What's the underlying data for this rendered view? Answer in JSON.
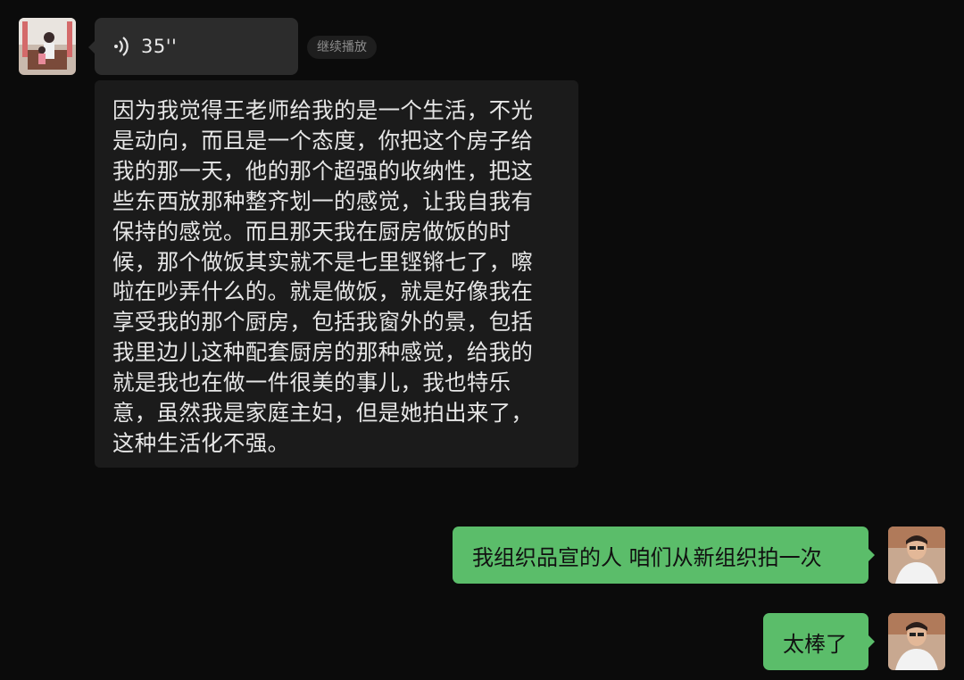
{
  "incoming": {
    "voice_message": {
      "duration": "35''",
      "action_label": "继续播放"
    },
    "transcript_lines": [
      "因为我觉得王老师给我的是一个生活，不光",
      "是动向，而且是一个态度，你把这个房子给",
      "我的那一天，他的那个超强的收纳性，把这",
      "些东西放那种整齐划一的感觉，让我自我有",
      "保持的感觉。而且那天我在厨房做饭的时",
      "候，那个做饭其实就不是七里铿锵七了，嚓",
      "啦在吵弄什么的。就是做饭，就是好像我在",
      "享受我的那个厨房，包括我窗外的景，包括",
      "我里边儿这种配套厨房的那种感觉，给我的",
      "就是我也在做一件很美的事儿，我也特乐",
      "意，虽然我是家庭主妇，但是她拍出来了，",
      "这种生活化不强。"
    ]
  },
  "outgoing": [
    {
      "text": "我组织品宣的人 咱们从新组织拍一次"
    },
    {
      "text": "太棒了"
    }
  ],
  "colors": {
    "background": "#0b0b0b",
    "voice_bubble": "#2c2c2c",
    "transcript_bg": "#1b1b1b",
    "outgoing_bubble": "#5bbd6a"
  },
  "icons": {
    "voice": "voice-wave-icon",
    "incoming_avatar": "contact-avatar",
    "outgoing_avatar": "self-avatar"
  }
}
